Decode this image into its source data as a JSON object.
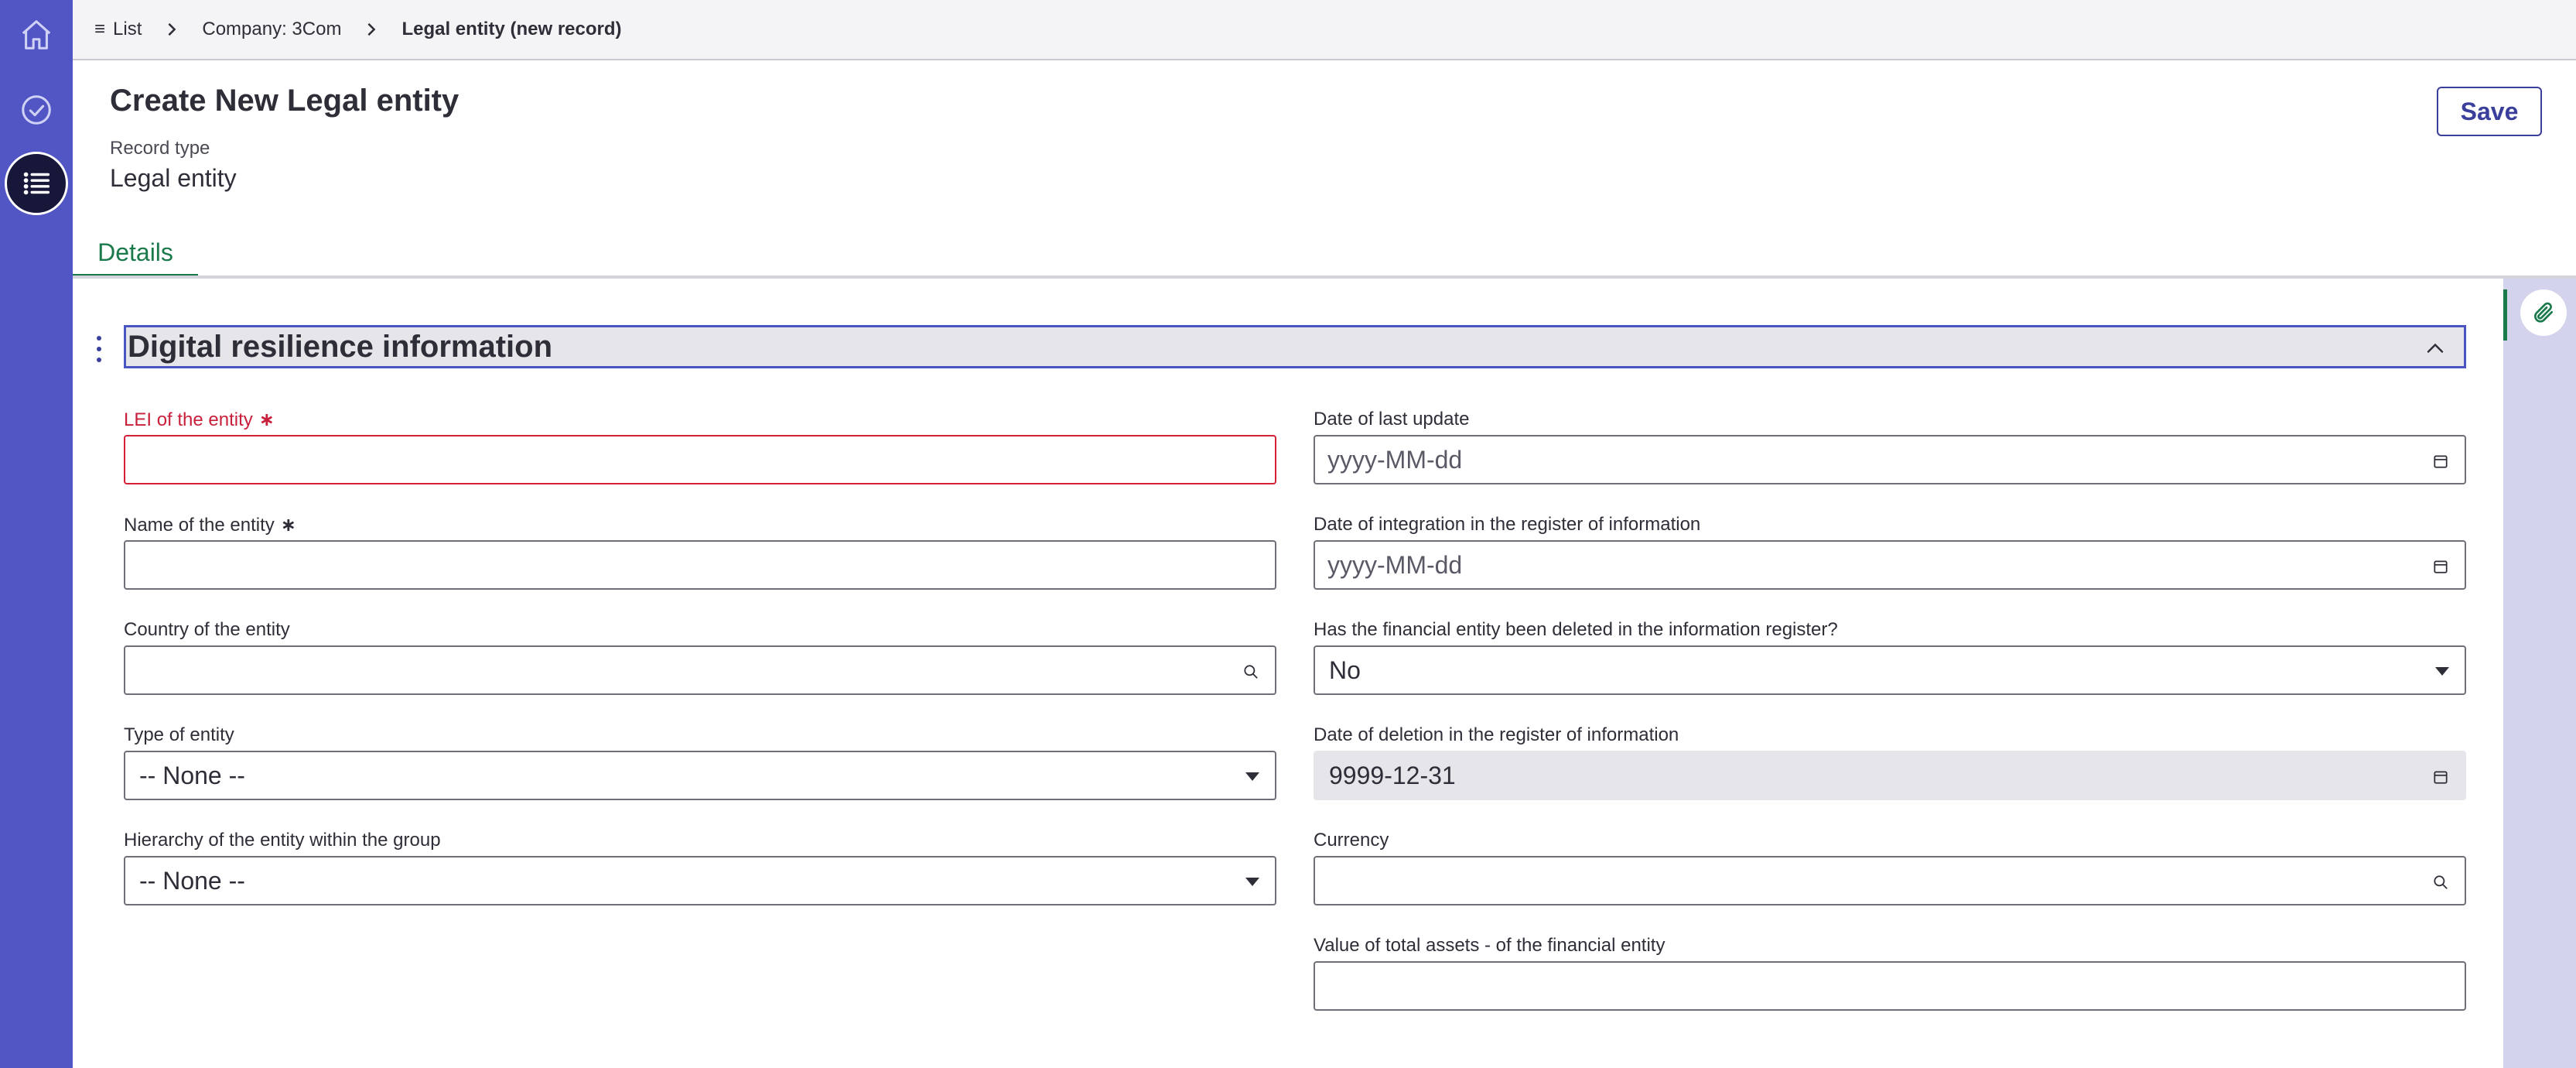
{
  "breadcrumb": {
    "list_label": "List",
    "company_label": "Company: 3Com",
    "current_label": "Legal entity (new record)"
  },
  "header": {
    "title": "Create New Legal entity",
    "record_type_label": "Record type",
    "record_type_value": "Legal entity",
    "save_label": "Save"
  },
  "tabs": [
    {
      "label": "Details"
    }
  ],
  "section": {
    "title": "Digital resilience information"
  },
  "fields": {
    "lei": {
      "label": "LEI of the entity",
      "required_mark": "∗",
      "value": ""
    },
    "name": {
      "label": "Name of the entity",
      "required_mark": "∗",
      "value": ""
    },
    "country": {
      "label": "Country of the entity",
      "value": ""
    },
    "type": {
      "label": "Type of entity",
      "value": "-- None --"
    },
    "hierarchy": {
      "label": "Hierarchy of the entity within the group",
      "value": "-- None --"
    },
    "last_update": {
      "label": "Date of last update",
      "placeholder": "yyyy-MM-dd"
    },
    "integration_date": {
      "label": "Date of integration in the register of information",
      "placeholder": "yyyy-MM-dd"
    },
    "deleted": {
      "label": "Has the financial entity been deleted in the information register?",
      "value": "No"
    },
    "deletion_date": {
      "label": "Date of deletion in the register of information",
      "value": "9999-12-31"
    },
    "currency": {
      "label": "Currency",
      "value": ""
    },
    "total_assets": {
      "label": "Value of total assets - of the financial entity",
      "value": ""
    }
  },
  "icons": {
    "rail": [
      "home-icon",
      "check-circle-icon",
      "list-icon"
    ],
    "attachment": "paperclip-icon",
    "calendar": "calendar-icon",
    "search": "search-icon"
  },
  "colors": {
    "rail_bg": "#5256c4",
    "accent": "#3a3f9c",
    "tab_active": "#1a7a4c",
    "error": "#c8203a",
    "section_border": "#4a55c4"
  }
}
